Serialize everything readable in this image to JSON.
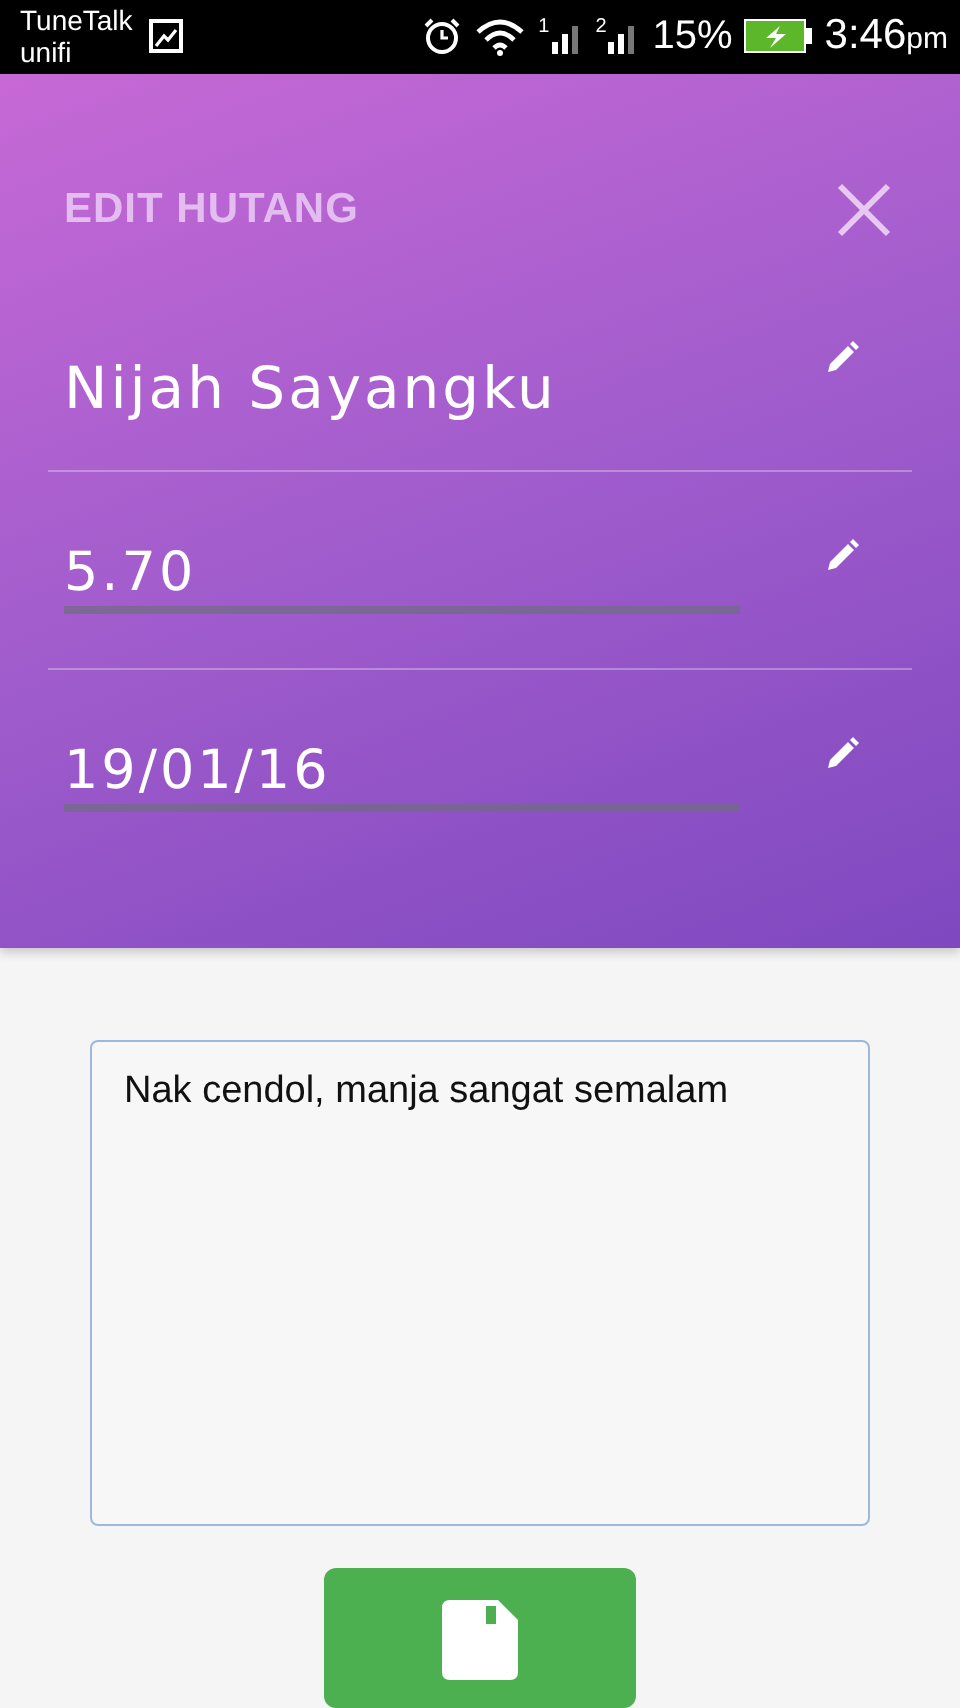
{
  "status_bar": {
    "carrier": [
      "TuneTalk",
      "unifi"
    ],
    "sim_labels": [
      "1",
      "2"
    ],
    "battery": "15%",
    "time": "3:46",
    "time_suffix": "pm"
  },
  "dialog": {
    "title": "EDIT HUTANG",
    "fields": [
      {
        "kind": "plain",
        "value": "Nijah Sayangku"
      },
      {
        "kind": "underlined",
        "value": "5.70"
      },
      {
        "kind": "underlined",
        "value": "19/01/16"
      }
    ],
    "note": {
      "value": "Nak cendol, manja sangat semalam"
    }
  }
}
